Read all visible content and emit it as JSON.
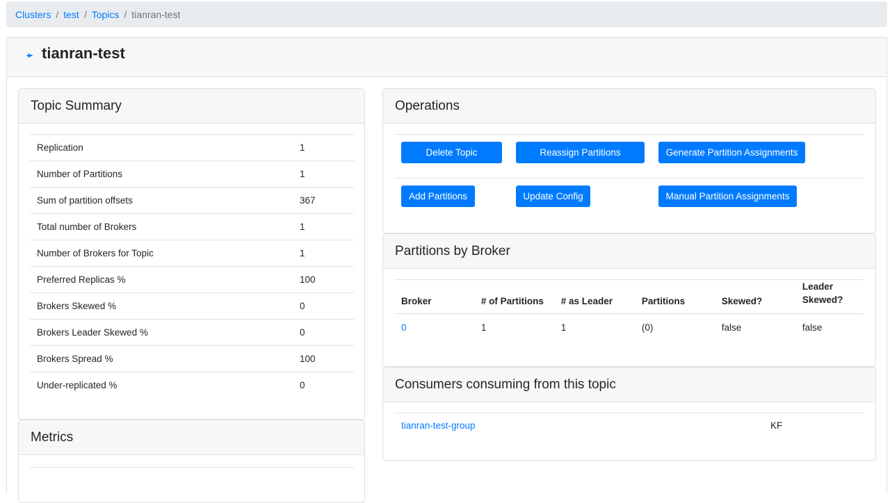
{
  "breadcrumb": {
    "items": [
      "Clusters",
      "test",
      "Topics"
    ],
    "current": "tianran-test",
    "separator": "/"
  },
  "page": {
    "title": "tianran-test",
    "back_icon": "back-arrow-icon"
  },
  "topic_summary": {
    "title": "Topic Summary",
    "rows": [
      {
        "label": "Replication",
        "value": "1"
      },
      {
        "label": "Number of Partitions",
        "value": "1"
      },
      {
        "label": "Sum of partition offsets",
        "value": "367"
      },
      {
        "label": "Total number of Brokers",
        "value": "1"
      },
      {
        "label": "Number of Brokers for Topic",
        "value": "1"
      },
      {
        "label": "Preferred Replicas %",
        "value": "100"
      },
      {
        "label": "Brokers Skewed %",
        "value": "0"
      },
      {
        "label": "Brokers Leader Skewed %",
        "value": "0"
      },
      {
        "label": "Brokers Spread %",
        "value": "100"
      },
      {
        "label": "Under-replicated %",
        "value": "0"
      }
    ]
  },
  "metrics": {
    "title": "Metrics"
  },
  "operations": {
    "title": "Operations",
    "buttons": {
      "delete_topic": "Delete Topic",
      "reassign_partitions": "Reassign Partitions",
      "generate_assignments": "Generate Partition Assignments",
      "add_partitions": "Add Partitions",
      "update_config": "Update Config",
      "manual_assignments": "Manual Partition Assignments"
    }
  },
  "partitions_by_broker": {
    "title": "Partitions by Broker",
    "headers": [
      "Broker",
      "# of Partitions",
      "# as Leader",
      "Partitions",
      "Skewed?",
      "Leader Skewed?"
    ],
    "rows": [
      {
        "broker": "0",
        "num_partitions": "1",
        "as_leader": "1",
        "partitions": "(0)",
        "skewed": "false",
        "leader_skewed": "false"
      }
    ]
  },
  "consumers": {
    "title": "Consumers consuming from this topic",
    "rows": [
      {
        "group": "tianran-test-group",
        "type": "KF"
      }
    ]
  },
  "colors": {
    "primary": "#007bff",
    "card_header_bg": "#f7f7f7",
    "breadcrumb_bg": "#e9ecef"
  }
}
